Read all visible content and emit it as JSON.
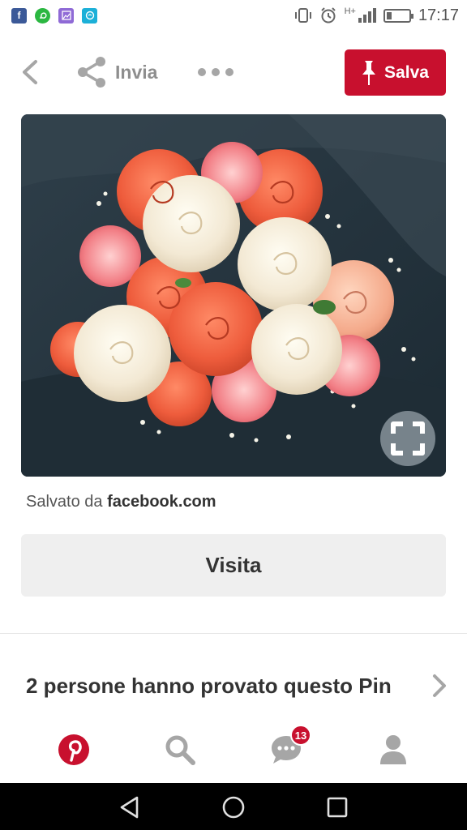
{
  "status_bar": {
    "notification_icons": [
      "facebook-icon",
      "whatsapp-icon",
      "gallery-icon",
      "messenger-icon"
    ],
    "network": "H+",
    "time": "17:17"
  },
  "toolbar": {
    "back_icon": "chevron-left-icon",
    "share_label": "Invia",
    "more_icon": "more-dots-icon",
    "save_label": "Salva"
  },
  "pin": {
    "image_subject": "bouquet-photo",
    "saved_from_prefix": "Salvato da",
    "saved_from_source": "facebook.com",
    "visit_label": "Visita",
    "tried_text": "2 persone hanno provato questo Pin"
  },
  "bottom_nav": {
    "items": [
      {
        "name": "home",
        "icon": "pinterest-logo-icon"
      },
      {
        "name": "search",
        "icon": "search-icon"
      },
      {
        "name": "messages",
        "icon": "chat-icon",
        "badge": "13"
      },
      {
        "name": "profile",
        "icon": "person-icon"
      }
    ]
  },
  "colors": {
    "brand_red": "#c8102e",
    "text_dark": "#333333",
    "text_muted": "#8e8e8e",
    "button_gray": "#efefef"
  }
}
